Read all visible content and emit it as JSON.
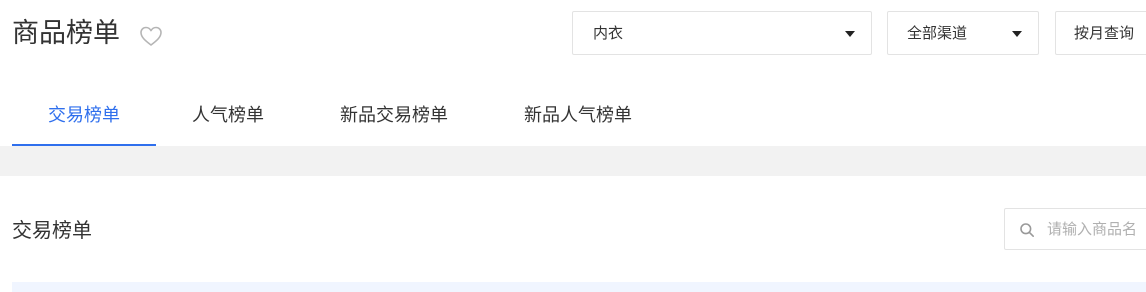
{
  "header": {
    "title": "商品榜单",
    "favorite_icon": "heart-outline-icon"
  },
  "filters": {
    "category": {
      "value": "内衣",
      "icon": "caret-down-icon"
    },
    "channel": {
      "value": "全部渠道",
      "icon": "caret-down-icon"
    },
    "period": {
      "label": "按月查询"
    }
  },
  "tabs": [
    {
      "label": "交易榜单",
      "active": true
    },
    {
      "label": "人气榜单",
      "active": false
    },
    {
      "label": "新品交易榜单",
      "active": false
    },
    {
      "label": "新品人气榜单",
      "active": false
    }
  ],
  "section": {
    "title": "交易榜单"
  },
  "search": {
    "placeholder": "请输入商品名",
    "icon": "search-icon"
  },
  "colors": {
    "accent": "#2f6fed",
    "band": "#f2f2f2",
    "table_header": "#f0f5ff"
  }
}
